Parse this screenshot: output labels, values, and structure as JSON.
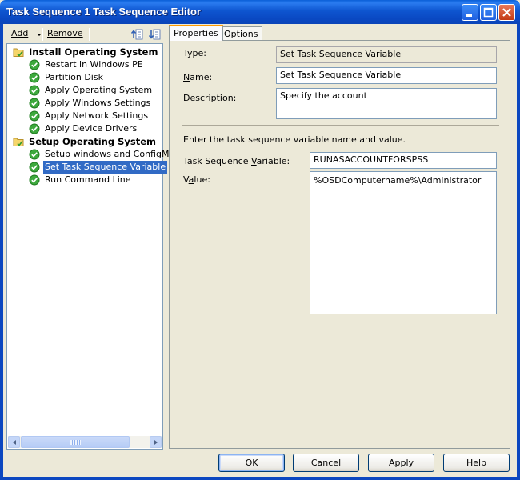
{
  "window": {
    "title": "Task Sequence 1 Task Sequence Editor"
  },
  "toolbar": {
    "add_label": "Add",
    "remove_label": "Remove"
  },
  "tree": {
    "items": [
      {
        "label": "Install Operating System",
        "type": "group",
        "icon": "folder-icon"
      },
      {
        "label": "Restart in Windows PE",
        "type": "step",
        "icon": "check-icon"
      },
      {
        "label": "Partition Disk",
        "type": "step",
        "icon": "check-icon"
      },
      {
        "label": "Apply Operating System",
        "type": "step",
        "icon": "check-icon"
      },
      {
        "label": "Apply Windows Settings",
        "type": "step",
        "icon": "check-icon"
      },
      {
        "label": "Apply Network Settings",
        "type": "step",
        "icon": "check-icon"
      },
      {
        "label": "Apply Device Drivers",
        "type": "step",
        "icon": "check-icon"
      },
      {
        "label": "Setup Operating System",
        "type": "group",
        "icon": "folder-icon"
      },
      {
        "label": "Setup windows and ConfigMgr",
        "type": "step",
        "icon": "check-icon"
      },
      {
        "label": "Set Task Sequence Variable",
        "type": "step",
        "icon": "check-icon",
        "selected": true
      },
      {
        "label": "Run Command Line",
        "type": "step",
        "icon": "check-icon"
      }
    ]
  },
  "tabs": [
    {
      "label": "Properties",
      "active": true
    },
    {
      "label": "Options",
      "active": false
    }
  ],
  "properties": {
    "type_label": "Type:",
    "type_value": "Set Task Sequence Variable",
    "name_label": "Name:",
    "name_value": "Set Task Sequence Variable",
    "description_label": "Description:",
    "description_value": "Specify the account",
    "instruction": "Enter the task sequence variable name and value.",
    "variable_label": "Task Sequence Variable:",
    "variable_value": "RUNASACCOUNTFORSPSS",
    "value_label": "Value:",
    "value_value": "%OSDComputername%\\Administrator"
  },
  "buttons": {
    "ok": "OK",
    "cancel": "Cancel",
    "apply": "Apply",
    "help": "Help"
  },
  "colors": {
    "titlebar": "#0A48C2",
    "selection": "#316AC5",
    "dialog_bg": "#ECE9D8"
  }
}
